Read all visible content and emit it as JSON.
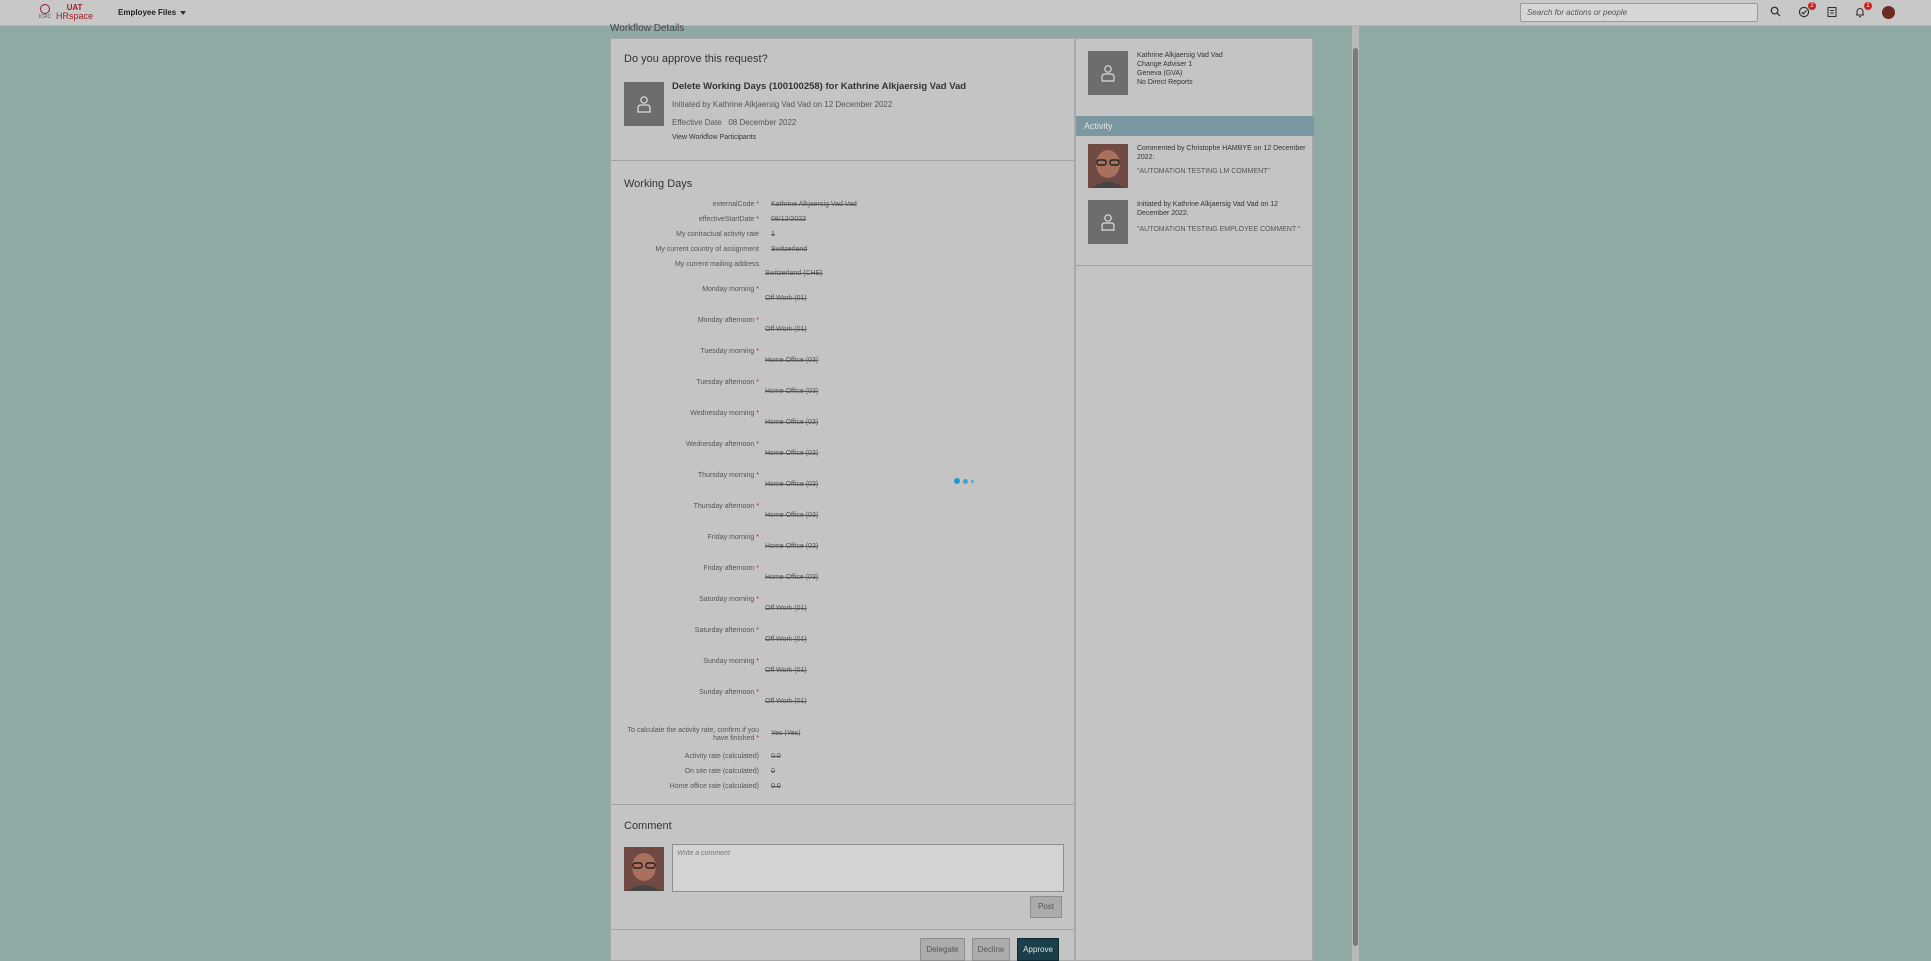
{
  "shell": {
    "logo_small": "ICRC",
    "logo_env": "UAT",
    "logo_name": "HRspace",
    "module": "Employee Files",
    "search_placeholder": "Search for actions or people",
    "badges": {
      "todo": "2",
      "notifications": "1"
    }
  },
  "breadcrumb": "Workflow Details",
  "request": {
    "question": "Do you approve this request?",
    "title": "Delete Working Days (100100258) for Kathrine Alkjaersig Vad Vad",
    "initiated": "Initiated by Kathrine Alkjaersig Vad Vad on 12 December 2022",
    "effective": "Effective Date   08 December 2022",
    "participants_link": "View Workflow Participants"
  },
  "working_days": {
    "title": "Working Days",
    "fields": [
      {
        "label": "externalCode",
        "req": true,
        "value": "Kathrine Alkjaersig Vad Vad"
      },
      {
        "label": "effectiveStartDate",
        "req": true,
        "value": "08/12/2022"
      },
      {
        "label": "My contractual activity rate",
        "req": false,
        "value": "1"
      },
      {
        "label": "My current country of assignment",
        "req": false,
        "value": "Switzerland"
      },
      {
        "label": "My current mailing address",
        "req": false,
        "value": "Switzerland (CHE)"
      },
      {
        "label": "Monday morning",
        "req": true,
        "value": "Off Work (01)"
      },
      {
        "label": "Monday afternoon",
        "req": true,
        "value": "Off Work (01)"
      },
      {
        "label": "Tuesday morning",
        "req": true,
        "value": "Home Office (03)"
      },
      {
        "label": "Tuesday afternoon",
        "req": true,
        "value": "Home Office (03)"
      },
      {
        "label": "Wednesday morning",
        "req": true,
        "value": "Home Office (03)"
      },
      {
        "label": "Wednesday afternoon",
        "req": true,
        "value": "Home Office (03)"
      },
      {
        "label": "Thursday morning",
        "req": true,
        "value": "Home Office (03)"
      },
      {
        "label": "Thursday afternoon",
        "req": true,
        "value": "Home Office (03)"
      },
      {
        "label": "Friday morning",
        "req": true,
        "value": "Home Office (03)"
      },
      {
        "label": "Friday afternoon",
        "req": true,
        "value": "Home Office (03)"
      },
      {
        "label": "Saturday morning",
        "req": true,
        "value": "Off Work (01)"
      },
      {
        "label": "Saturday afternoon",
        "req": true,
        "value": "Off Work (01)"
      },
      {
        "label": "Sunday morning",
        "req": true,
        "value": "Off Work (01)"
      },
      {
        "label": "Sunday afternoon",
        "req": true,
        "value": "Off Work (01)"
      },
      {
        "label": "To calculate the activity rate, confirm if you have finished",
        "req": true,
        "value": "Yes (Yes)"
      },
      {
        "label": "Activity rate (calculated)",
        "req": false,
        "value": "0.0"
      },
      {
        "label": "On site rate (calculated)",
        "req": false,
        "value": "0"
      },
      {
        "label": "Home office rate (calculated)",
        "req": false,
        "value": "0.0"
      }
    ]
  },
  "comment": {
    "title": "Comment",
    "placeholder": "Write a comment",
    "post": "Post"
  },
  "actions": {
    "delegate": "Delegate",
    "decline": "Decline",
    "approve": "Approve"
  },
  "profile": {
    "name": "Kathrine Alkjaersig Vad Vad",
    "role": "Change Adviser 1",
    "location": "Geneva (GVA)",
    "reports": "No Direct Reports"
  },
  "activity": {
    "title": "Activity",
    "items": [
      {
        "text": "Commented by Christophe HAMBYE on 12 December 2022:",
        "quote": "\"AUTOMATION TESTING LM COMMENT\""
      },
      {
        "text": "Initiated by Kathrine Alkjaersig Vad Vad on 12 December 2022.",
        "quote": "\"AUTOMATION TESTING EMPLOYEE COMMENT \""
      }
    ]
  }
}
